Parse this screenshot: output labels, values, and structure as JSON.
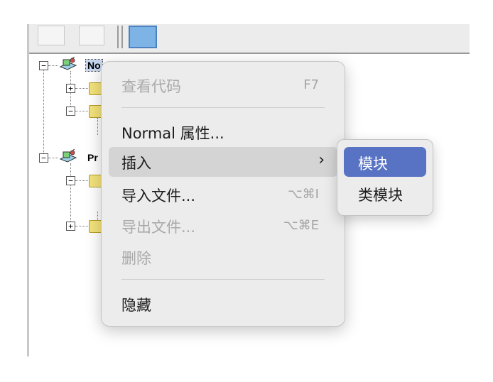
{
  "tree": {
    "nodes": [
      {
        "label": "No",
        "expanded": true,
        "selected": true
      },
      {
        "label": "Pr",
        "expanded": true,
        "selected": false
      }
    ]
  },
  "context_menu": {
    "items": [
      {
        "label": "查看代码",
        "shortcut": "F7",
        "enabled": false
      },
      {
        "label": "Normal 属性...",
        "shortcut": "",
        "enabled": true
      },
      {
        "label": "插入",
        "shortcut": "",
        "enabled": true,
        "submenu": true,
        "highlighted": true
      },
      {
        "label": "导入文件...",
        "shortcut": "⌥⌘I",
        "enabled": true
      },
      {
        "label": "导出文件...",
        "shortcut": "⌥⌘E",
        "enabled": false
      },
      {
        "label": "删除",
        "shortcut": "",
        "enabled": false
      },
      {
        "label": "隐藏",
        "shortcut": "",
        "enabled": true
      }
    ]
  },
  "submenu": {
    "items": [
      {
        "label": "模块",
        "active": true
      },
      {
        "label": "类模块",
        "active": false
      }
    ]
  },
  "colors": {
    "menu_bg": "#ececec",
    "highlight": "#d4d4d4",
    "submenu_active": "#5872c4",
    "disabled_text": "#a9a9a9"
  }
}
